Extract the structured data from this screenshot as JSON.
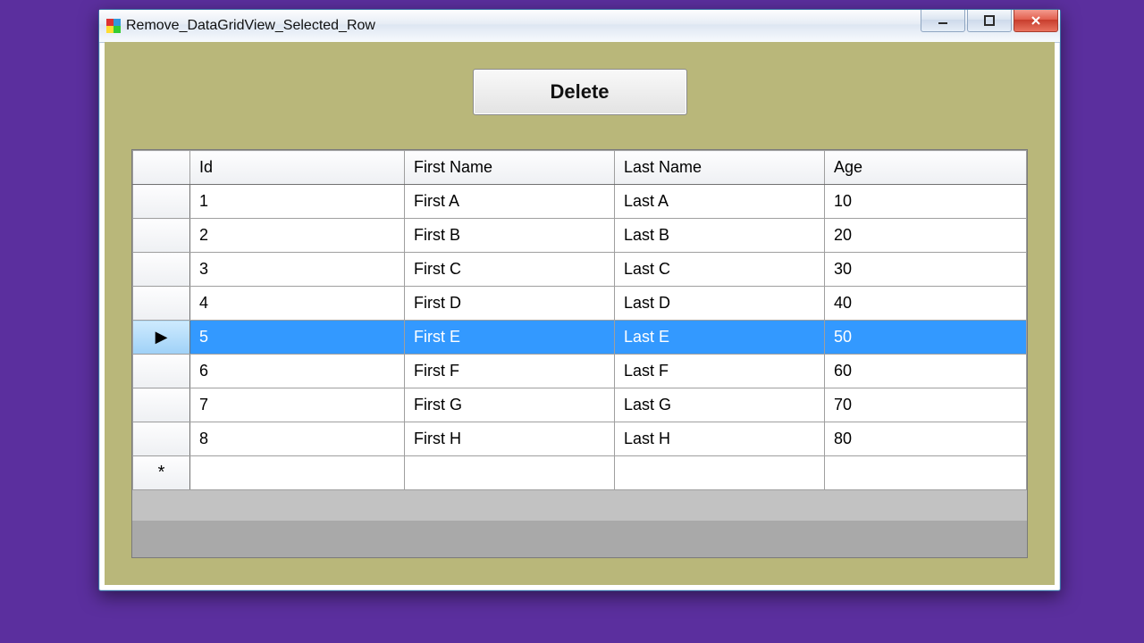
{
  "window": {
    "title": "Remove_DataGridView_Selected_Row"
  },
  "buttons": {
    "delete": "Delete"
  },
  "grid": {
    "columns": [
      "Id",
      "First Name",
      "Last Name",
      "Age"
    ],
    "selected_index": 4,
    "rows": [
      {
        "id": "1",
        "first": "First A",
        "last": "Last A",
        "age": "10"
      },
      {
        "id": "2",
        "first": "First B",
        "last": "Last B",
        "age": "20"
      },
      {
        "id": "3",
        "first": "First C",
        "last": "Last C",
        "age": "30"
      },
      {
        "id": "4",
        "first": "First D",
        "last": "Last D",
        "age": "40"
      },
      {
        "id": "5",
        "first": "First E",
        "last": "Last E",
        "age": "50"
      },
      {
        "id": "6",
        "first": "First F",
        "last": "Last F",
        "age": "60"
      },
      {
        "id": "7",
        "first": "First G",
        "last": "Last G",
        "age": "70"
      },
      {
        "id": "8",
        "first": "First H",
        "last": "Last H",
        "age": "80"
      }
    ],
    "new_row_marker": "*",
    "row_pointer": "▶"
  }
}
